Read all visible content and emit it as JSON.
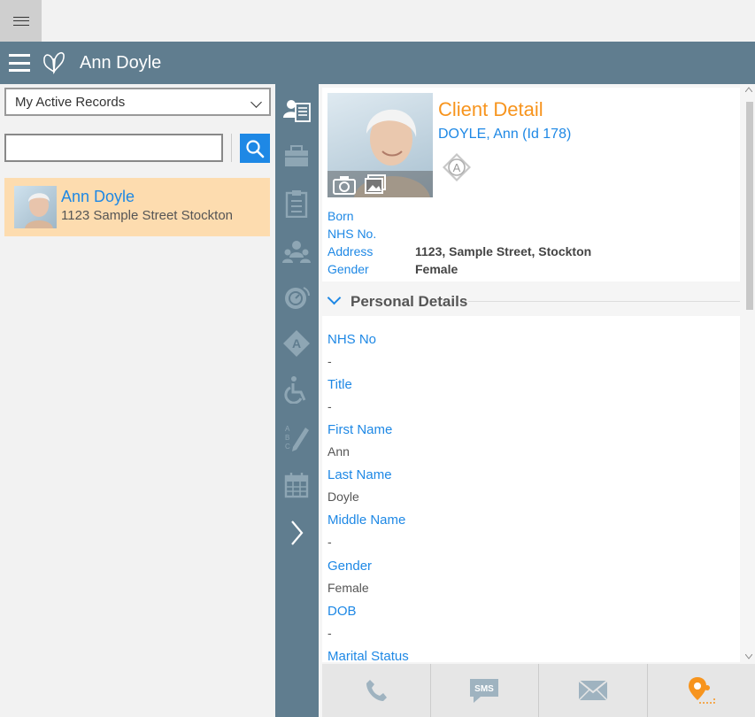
{
  "window": {
    "system_menu_icon": "hamburger-icon"
  },
  "app": {
    "title": "Ann Doyle",
    "logo_icon": "butterfly-logo-icon",
    "menu_icon": "hamburger-icon"
  },
  "left": {
    "filter_selected": "My Active Records",
    "search_value": "",
    "records": [
      {
        "name": "Ann Doyle",
        "address": "1123 Sample Street Stockton"
      }
    ]
  },
  "rail": {
    "icons": [
      "client-detail-icon",
      "briefcase-icon",
      "clipboard-icon",
      "people-icon",
      "alarm-icon",
      "alert-icon",
      "wheelchair-icon",
      "abc-pen-icon",
      "calendar-icon",
      "chevron-right-icon"
    ]
  },
  "client": {
    "title": "Client Detail",
    "subtitle": "DOYLE, Ann (Id 178)",
    "alert_letter": "A",
    "summary": [
      {
        "label": "Born",
        "value": ""
      },
      {
        "label": "NHS No.",
        "value": ""
      },
      {
        "label": "Address",
        "value": "1123, Sample Street, Stockton"
      },
      {
        "label": "Gender",
        "value": "Female"
      }
    ]
  },
  "personal": {
    "heading": "Personal Details",
    "fields": [
      {
        "label": "NHS No",
        "value": "-"
      },
      {
        "label": "Title",
        "value": "-"
      },
      {
        "label": "First Name",
        "value": "Ann"
      },
      {
        "label": "Last Name",
        "value": "Doyle"
      },
      {
        "label": "Middle Name",
        "value": "-"
      },
      {
        "label": "Gender",
        "value": "Female"
      },
      {
        "label": "DOB",
        "value": "-"
      },
      {
        "label": "Marital Status",
        "value": ""
      }
    ]
  },
  "bottom": {
    "buttons": [
      {
        "icon": "phone-icon"
      },
      {
        "icon": "sms-icon",
        "label": "SMS"
      },
      {
        "icon": "mail-icon"
      },
      {
        "icon": "map-pin-icon"
      }
    ]
  },
  "colors": {
    "accent_blue": "#1e88e5",
    "header_orange": "#f7941d",
    "chrome": "#607d8f",
    "selected_row": "#fddcaf"
  }
}
